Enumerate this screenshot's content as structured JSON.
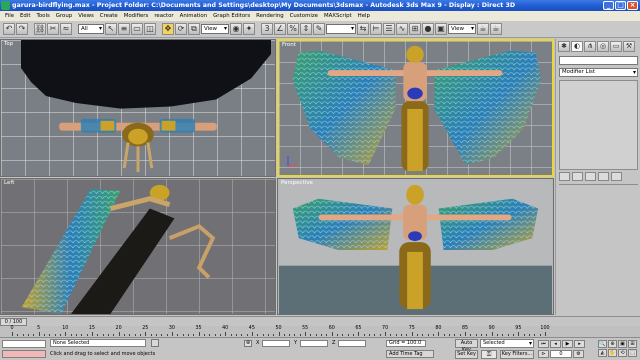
{
  "window": {
    "title": "garura-birdflying.max - Project Folder: C:\\Documents and Settings\\desktop\\My Documents\\3dsmax - Autodesk 3ds Max 9 - Display : Direct 3D",
    "buttons": {
      "minimize": "_",
      "maximize": "□",
      "close": "×"
    }
  },
  "menu": {
    "items": [
      "File",
      "Edit",
      "Tools",
      "Group",
      "Views",
      "Create",
      "Modifiers",
      "reactor",
      "Animation",
      "Graph Editors",
      "Rendering",
      "Customize",
      "MAXScript",
      "Help"
    ]
  },
  "toolbar": {
    "selection_filter": "All",
    "reference_coord": "View",
    "named_selection": ""
  },
  "viewports": {
    "top": {
      "label": "Top"
    },
    "front": {
      "label": "Front"
    },
    "left": {
      "label": "Left"
    },
    "perspective": {
      "label": "Perspective"
    }
  },
  "command_panel": {
    "modifier_list": "Modifier List",
    "view_dropdown": "View"
  },
  "time": {
    "slider_label": "0 / 100",
    "ticks": [
      "0",
      "5",
      "10",
      "15",
      "20",
      "25",
      "30",
      "35",
      "40",
      "45",
      "50",
      "55",
      "60",
      "65",
      "70",
      "75",
      "80",
      "85",
      "90",
      "95",
      "100"
    ]
  },
  "status": {
    "selection": "None Selected",
    "prompt": "Click and drag to select and move objects",
    "coord_labels": [
      "X",
      "Y",
      "Z"
    ],
    "grid": "Grid = 100.0",
    "add_time_tag": "Add Time Tag",
    "auto_key": "Auto Key",
    "set_key": "Set Key",
    "selected_dropdown": "Selected",
    "key_filters": "Key Filters...",
    "frame_value": "0"
  },
  "colors": {
    "active_viewport_border": "#e8d63a",
    "title_bar": "#1f5ad0",
    "wing_blue": "#2b7fb8",
    "wing_green": "#5aa84a",
    "gold": "#c9a227"
  }
}
